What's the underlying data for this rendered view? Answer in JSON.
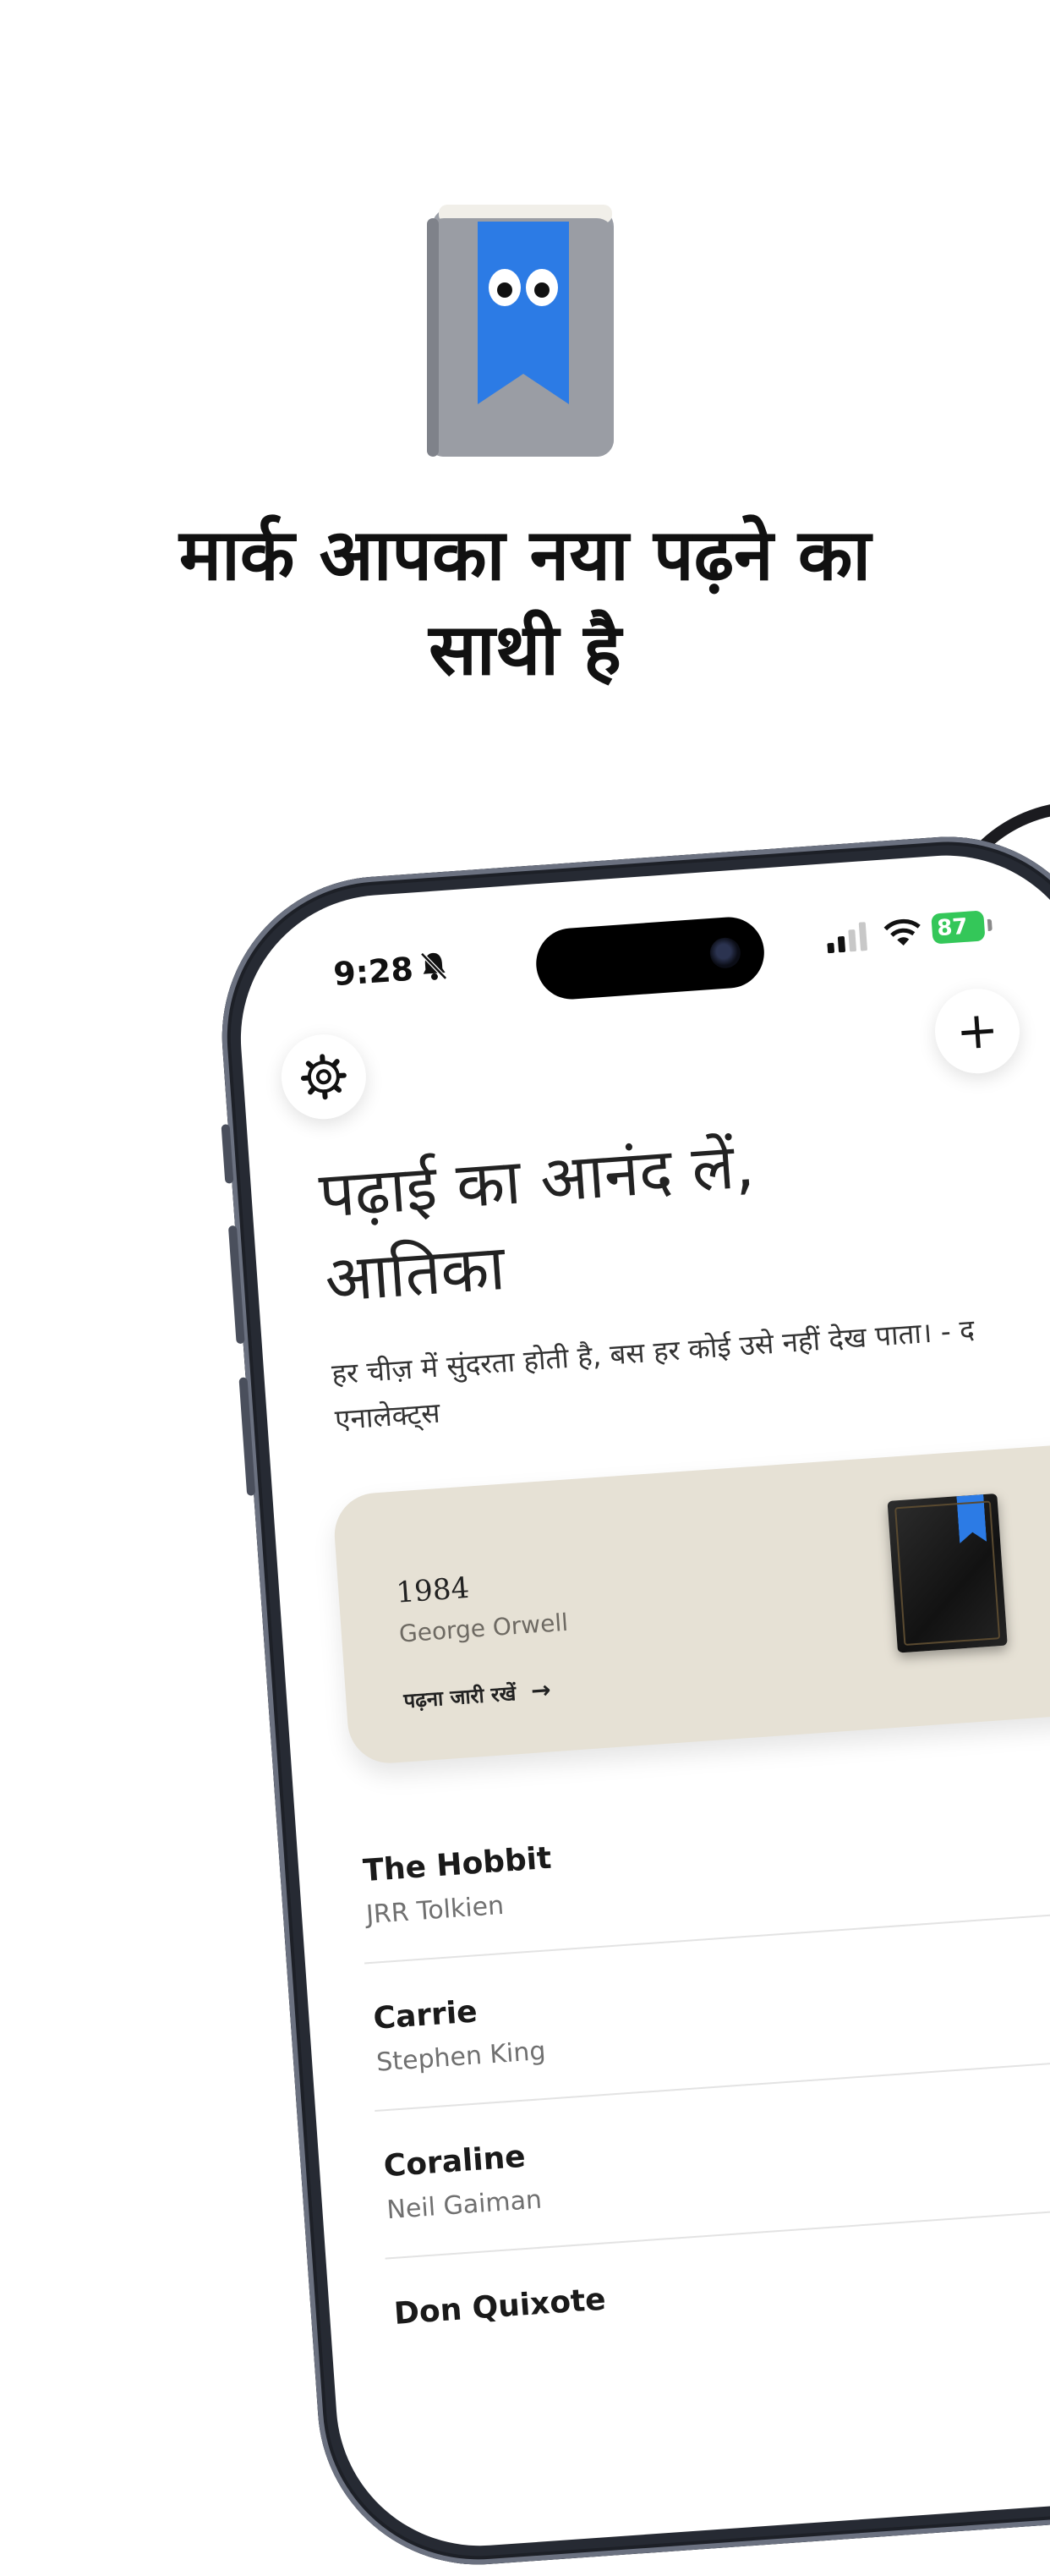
{
  "headline": {
    "line1": "मार्क आपका नया पढ़ने का",
    "line2": "साथी है"
  },
  "status_bar": {
    "time": "9:28",
    "battery": "87"
  },
  "greeting": {
    "line1": "पढ़ाई का आनंद लें,",
    "line2": "आतिका"
  },
  "quote": "हर चीज़ में सुंदरता होती है, बस हर कोई उसे नहीं देख पाता। - द एनालेक्ट्स",
  "current_book": {
    "title": "1984",
    "author": "George Orwell",
    "continue_label": "पढ़ना जारी रखें",
    "arrow": "→"
  },
  "add_symbol": "+",
  "books": [
    {
      "title": "The Hobbit",
      "author": "JRR Tolkien"
    },
    {
      "title": "Carrie",
      "author": "Stephen King"
    },
    {
      "title": "Coraline",
      "author": "Neil Gaiman"
    },
    {
      "title": "Don Quixote",
      "author": ""
    }
  ],
  "colors": {
    "bookmark_blue": "#2c7be5",
    "card_beige": "#e6e1d5",
    "battery_green": "#34c759",
    "phone_frame": "#262a33"
  }
}
